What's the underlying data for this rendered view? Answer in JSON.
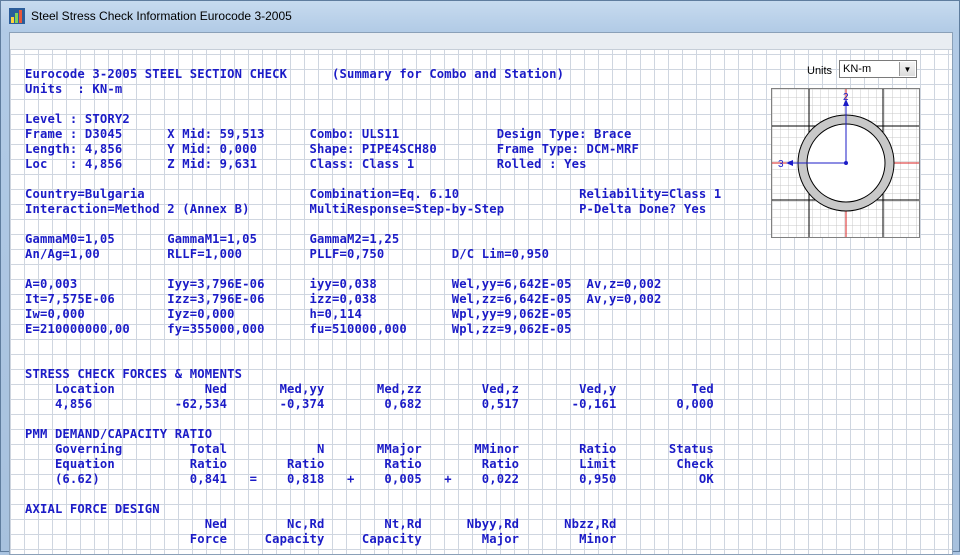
{
  "window": {
    "title": "Steel Stress Check Information  Eurocode 3-2005"
  },
  "units": {
    "label": "Units",
    "selected": "KN-m"
  },
  "section_axes": {
    "axis2": "2",
    "axis3": "3"
  },
  "report": {
    "lines": [
      "Eurocode 3-2005 STEEL SECTION CHECK      (Summary for Combo and Station)",
      "Units  : KN-m",
      "",
      "Level : STORY2",
      "Frame : D3045      X Mid: 59,513      Combo: ULS11             Design Type: Brace",
      "Length: 4,856      Y Mid: 0,000       Shape: PIPE4SCH80        Frame Type: DCM-MRF",
      "Loc   : 4,856      Z Mid: 9,631       Class: Class 1           Rolled : Yes",
      "",
      "Country=Bulgaria                      Combination=Eq. 6.10                Reliability=Class 1",
      "Interaction=Method 2 (Annex B)        MultiResponse=Step-by-Step          P-Delta Done? Yes",
      "",
      "GammaM0=1,05       GammaM1=1,05       GammaM2=1,25",
      "An/Ag=1,00         RLLF=1,000         PLLF=0,750         D/C Lim=0,950",
      "",
      "A=0,003            Iyy=3,796E-06      iyy=0,038          Wel,yy=6,642E-05  Av,z=0,002",
      "It=7,575E-06       Izz=3,796E-06      izz=0,038          Wel,zz=6,642E-05  Av,y=0,002",
      "Iw=0,000           Iyz=0,000          h=0,114            Wpl,yy=9,062E-05",
      "E=210000000,00     fy=355000,000      fu=510000,000      Wpl,zz=9,062E-05",
      "",
      "",
      "STRESS CHECK FORCES & MOMENTS",
      "    Location            Ned       Med,yy       Med,zz        Ved,z        Ved,y          Ted",
      "    4,856           -62,534       -0,374        0,682        0,517       -0,161        0,000",
      "",
      "PMM DEMAND/CAPACITY RATIO",
      "    Governing         Total            N       MMajor       MMinor        Ratio       Status",
      "    Equation          Ratio        Ratio        Ratio        Ratio        Limit        Check",
      "    (6.62)            0,841   =    0,818   +    0,005   +    0,022        0,950           OK",
      "",
      "AXIAL FORCE DESIGN",
      "                        Ned        Nc,Rd        Nt,Rd      Nbyy,Rd      Nbzz,Rd",
      "                      Force     Capacity     Capacity        Major        Minor"
    ]
  }
}
